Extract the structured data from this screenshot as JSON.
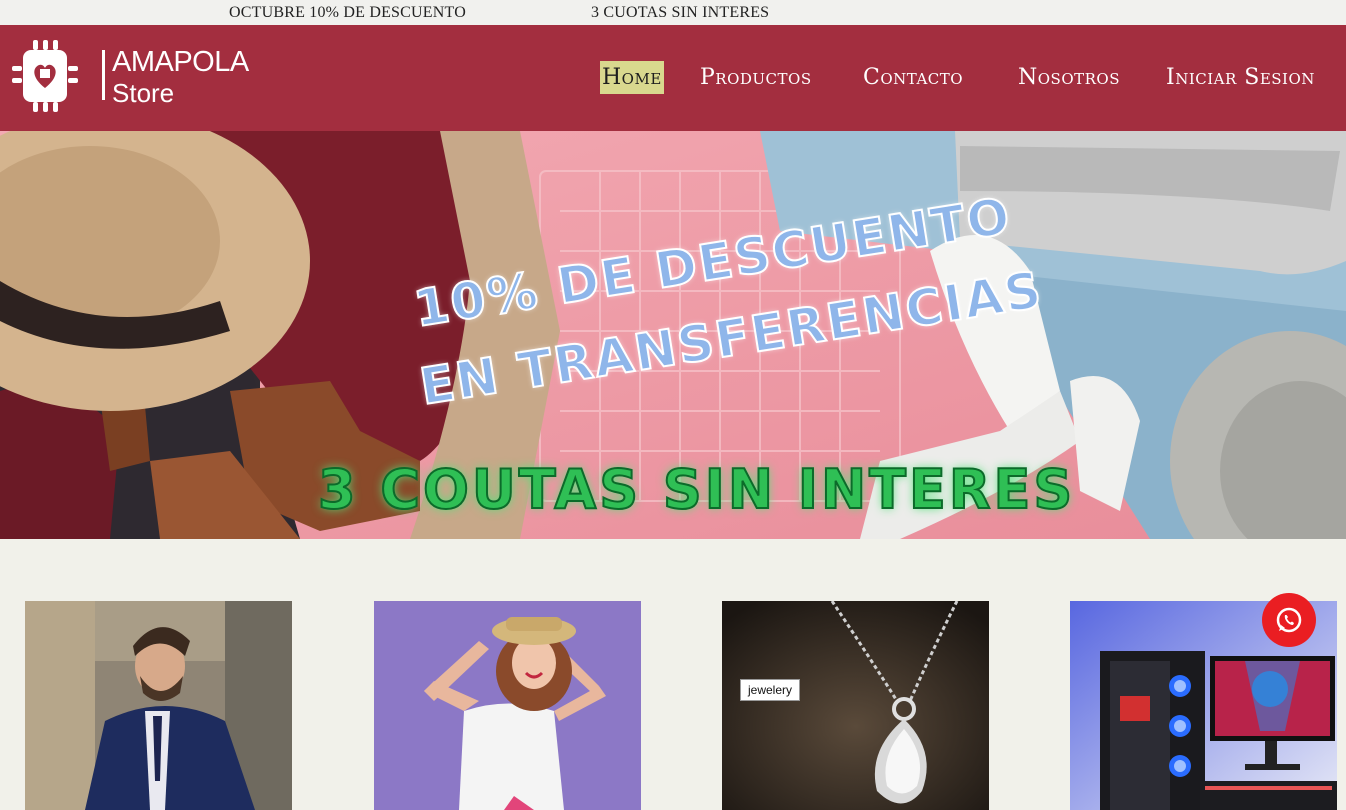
{
  "topbar": {
    "promo_1": "OCTUBRE 10% DE DESCUENTO",
    "promo_2": "3 CUOTAS SIN INTERES"
  },
  "brand": {
    "name": "AMAPOLA",
    "sub": "Store",
    "icon": "chip-heart-icon"
  },
  "nav": {
    "items": [
      {
        "label": "Home",
        "active": true
      },
      {
        "label": "Productos",
        "active": false
      },
      {
        "label": "Contacto",
        "active": false
      },
      {
        "label": "Nosotros",
        "active": false
      },
      {
        "label": "Iniciar Sesion",
        "active": false
      }
    ]
  },
  "banner": {
    "line_1": "10% DE DESCUENTO",
    "line_2": "EN TRANSFERENCIAS",
    "line_3": "3 COUTAS SIN INTERES"
  },
  "products": [
    {
      "image": "man-in-blue-suit",
      "tag": ""
    },
    {
      "image": "woman-in-straw-hat",
      "tag": ""
    },
    {
      "image": "silver-pendant-necklace",
      "tag": "jewelery"
    },
    {
      "image": "gaming-pc-setup",
      "tag": ""
    }
  ],
  "colors": {
    "header": "#a32e3f",
    "nav_active_bg": "#d9d88e",
    "page_bg": "#f1f1ea",
    "whatsapp": "#ea1e22"
  },
  "whatsapp": {
    "icon": "whatsapp-icon"
  }
}
